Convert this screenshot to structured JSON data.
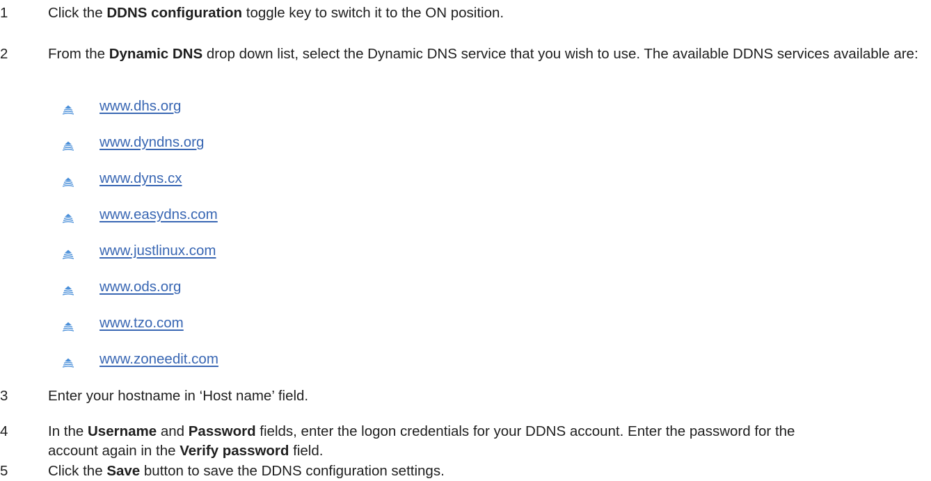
{
  "steps": [
    {
      "number": "1",
      "parts": [
        {
          "t": "Click the "
        },
        {
          "t": "DDNS configuration",
          "b": true
        },
        {
          "t": " toggle key to switch it to the ON position."
        }
      ]
    },
    {
      "number": "2",
      "parts": [
        {
          "t": "From the "
        },
        {
          "t": "Dynamic DNS",
          "b": true
        },
        {
          "t": " drop down list, select the Dynamic DNS service that you wish to use. The available DDNS services available are:"
        }
      ]
    },
    {
      "number": "3",
      "parts": [
        {
          "t": "Enter your hostname in ‘Host name’ field."
        }
      ]
    },
    {
      "number": "4",
      "parts": [
        {
          "t": "In the "
        },
        {
          "t": "Username",
          "b": true
        },
        {
          "t": " and "
        },
        {
          "t": "Password",
          "b": true
        },
        {
          "t": " fields, enter the logon credentials for your DDNS account. Enter the password for the account again in the "
        },
        {
          "t": "Verify password",
          "b": true
        },
        {
          "t": " field."
        }
      ]
    },
    {
      "number": "5",
      "parts": [
        {
          "t": "Click the "
        },
        {
          "t": "Save",
          "b": true
        },
        {
          "t": " button to save the DDNS configuration settings."
        }
      ]
    }
  ],
  "ddns_services": [
    "www.dhs.org",
    "www.dyndns.org",
    "www.dyns.cx",
    "www.easydns.com",
    "www.justlinux.com",
    "www.ods.org",
    "www.tzo.com",
    "www.zoneedit.com"
  ],
  "colors": {
    "link": "#3866b3",
    "bullet": "#4a8fd9",
    "text": "#1e1e1e"
  },
  "bullet_icon": "layered-fan-bullet-icon"
}
